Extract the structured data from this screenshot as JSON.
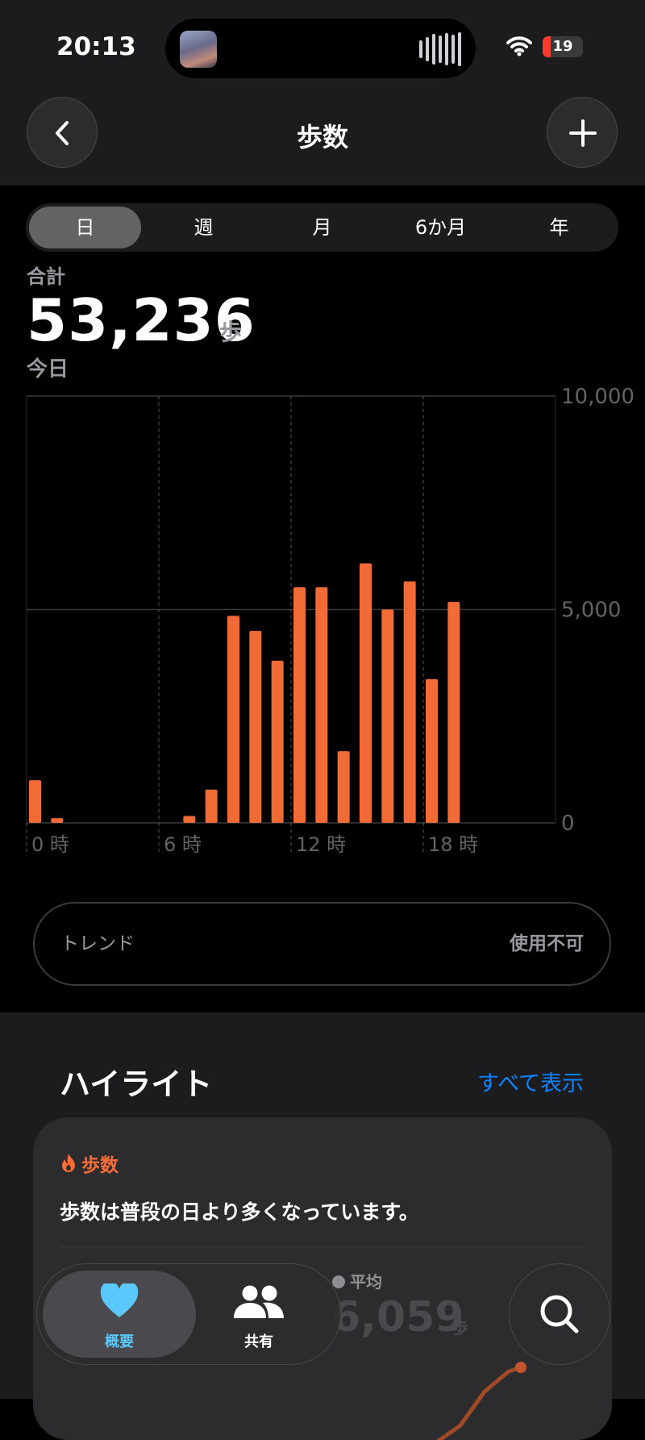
{
  "status": {
    "time": "20:13",
    "battery": "19",
    "battery_level": 0.19
  },
  "nav": {
    "title": "歩数"
  },
  "segments": {
    "items": [
      "日",
      "週",
      "月",
      "6か月",
      "年"
    ],
    "active": 0
  },
  "summary": {
    "label": "合計",
    "value": "53,236",
    "unit": "歩",
    "date": "今日"
  },
  "chart_data": {
    "type": "bar",
    "x": [
      0,
      1,
      2,
      3,
      4,
      5,
      6,
      7,
      8,
      9,
      10,
      11,
      12,
      13,
      14,
      15,
      16,
      17,
      18,
      19,
      20,
      21,
      22,
      23
    ],
    "values": [
      1000,
      110,
      0,
      0,
      0,
      0,
      0,
      160,
      780,
      4850,
      4500,
      3800,
      5520,
      5520,
      1680,
      6080,
      5000,
      5660,
      3370,
      5180,
      0,
      0,
      0,
      0
    ],
    "ylim": [
      0,
      10000
    ],
    "y_ticks": [
      0,
      5000,
      10000
    ],
    "y_tick_labels": [
      "0",
      "5,000",
      "10,000"
    ],
    "x_tick_labels": [
      "0 時",
      "6 時",
      "12 時",
      "18 時"
    ],
    "bar_color": "#f26a35",
    "grid": true
  },
  "trend": {
    "label": "トレンド",
    "value": "使用不可"
  },
  "highlights": {
    "title": "ハイライト",
    "link": "すべて表示",
    "card": {
      "category": "歩数",
      "text": "歩数は普段の日より多くなっています。",
      "average_label": "平均",
      "average_value": "6,059",
      "average_unit": "歩"
    }
  },
  "tabs": {
    "overview": "概要",
    "sharing": "共有"
  },
  "colors": {
    "accent": "#0a84ff",
    "steps": "#f26a35",
    "heart": "#5ac8fa"
  }
}
